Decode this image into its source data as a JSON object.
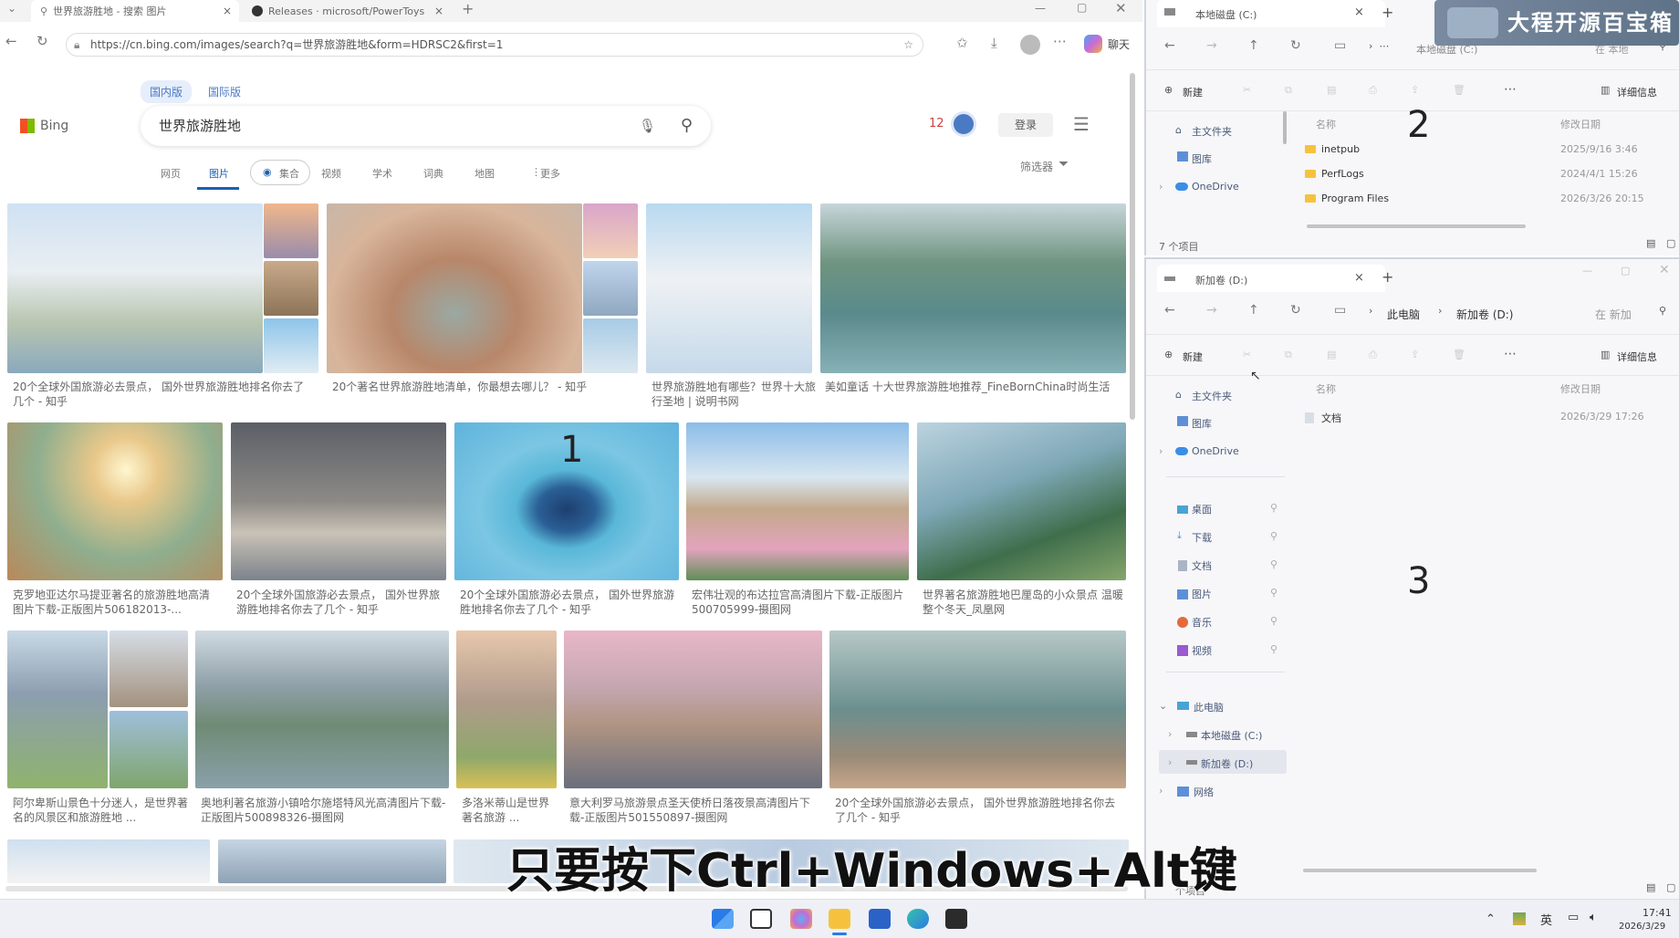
{
  "browser": {
    "tabs": [
      {
        "label": "世界旅游胜地 - 搜索 图片",
        "active": true
      },
      {
        "label": "Releases · microsoft/PowerToys",
        "active": false
      }
    ],
    "url": "https://cn.bing.com/images/search?q=世界旅游胜地&form=HDRSC2&first=1",
    "chat_label": "聊天"
  },
  "bing": {
    "logo": "Bing",
    "scopes": [
      "国内版",
      "国际版"
    ],
    "query": "世界旅游胜地",
    "points": "12",
    "login": "登录",
    "nav": [
      "网页",
      "图片",
      "集合",
      "视频",
      "学术",
      "词典",
      "地图",
      "更多"
    ],
    "filter": "筛选器",
    "captions": [
      "20个全球外国旅游必去景点， 国外世界旅游胜地排名你去了几个 - 知乎",
      "20个著名世界旅游胜地清单，你最想去哪儿？ - 知乎",
      "世界旅游胜地有哪些？世界十大旅行圣地 | 说明书网",
      "美如童话 十大世界旅游胜地推荐_FineBornChina时尚生活",
      "克罗地亚达尔马提亚著名的旅游胜地高清图片下载-正版图片506182013-...",
      "20个全球外国旅游必去景点， 国外世界旅游胜地排名你去了几个 - 知乎",
      "20个全球外国旅游必去景点， 国外世界旅游胜地排名你去了几个 - 知乎",
      "宏伟壮观的布达拉宫高清图片下载-正版图片500705999-摄图网",
      "世界著名旅游胜地巴厘岛的小众景点 温暖整个冬天_凤凰网",
      "阿尔卑斯山景色十分迷人，是世界著名的风景区和旅游胜地 ...",
      "奥地利著名旅游小镇哈尔施塔特风光高清图片下载-正版图片500898326-摄图网",
      "多洛米蒂山是世界著名旅游 ...",
      "意大利罗马旅游景点圣天使桥日落夜景高清图片下载-正版图片501550897-摄图网",
      "20个全球外国旅游必去景点， 国外世界旅游胜地排名你去了几个 - 知乎"
    ],
    "zone_label": "1"
  },
  "explorer_c": {
    "title": "本地磁盘 (C:)",
    "path_partial": "本地磁盘 (C:)",
    "search_placeholder": "在 本地",
    "new_label": "新建",
    "details_label": "详细信息",
    "sidebar": [
      "主文件夹",
      "图库",
      "OneDrive"
    ],
    "col_name": "名称",
    "col_date": "修改日期",
    "files": [
      {
        "name": "inetpub",
        "date": "2025/9/16 3:46"
      },
      {
        "name": "PerfLogs",
        "date": "2024/4/1 15:26"
      },
      {
        "name": "Program Files",
        "date": "2026/3/26 20:15"
      }
    ],
    "status": "7 个项目",
    "zone_label": "2"
  },
  "explorer_d": {
    "title": "新加卷 (D:)",
    "path": [
      "此电脑",
      "新加卷 (D:)"
    ],
    "search_placeholder": "在 新加",
    "new_label": "新建",
    "details_label": "详细信息",
    "sidebar_top": [
      "主文件夹",
      "图库",
      "OneDrive"
    ],
    "quick": [
      "桌面",
      "下载",
      "文档",
      "图片",
      "音乐",
      "视频"
    ],
    "tree": [
      "此电脑",
      "本地磁盘 (C:)",
      "新加卷 (D:)",
      "网络"
    ],
    "col_name": "名称",
    "col_date": "修改日期",
    "files": [
      {
        "name": "文档",
        "date": "2026/3/29 17:26"
      }
    ],
    "status": "个项目",
    "zone_label": "3"
  },
  "overlay": {
    "subtitle": "只要按下Ctrl+Windows+Alt键",
    "badge": "大程开源百宝箱"
  },
  "taskbar": {
    "ime": "英",
    "time": "17:41",
    "date": "2026/3/29"
  }
}
